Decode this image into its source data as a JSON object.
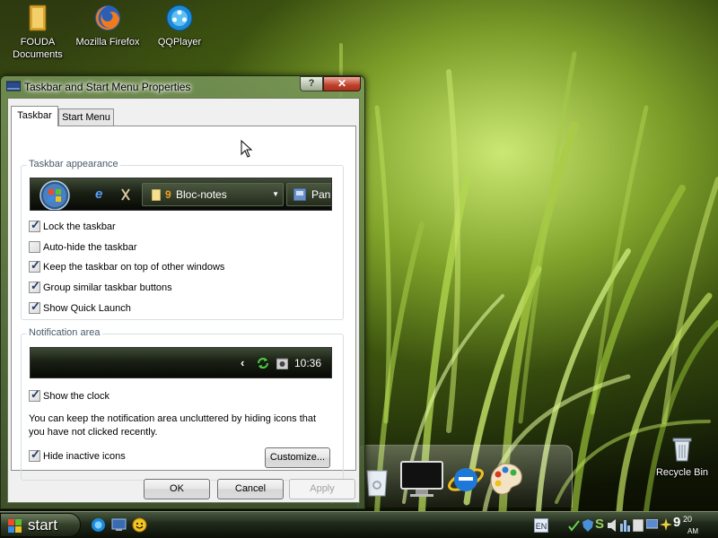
{
  "desktop": {
    "icons": [
      {
        "label": "FOUDA\nDocuments"
      },
      {
        "label": "Mozilla Firefox"
      },
      {
        "label": "QQPlayer"
      },
      {
        "label": "Recycle Bin"
      }
    ]
  },
  "window": {
    "title": "Taskbar and Start Menu Properties",
    "help_label": "?",
    "close_label": "✕",
    "tabs": [
      {
        "label": "Taskbar"
      },
      {
        "label": "Start Menu"
      }
    ],
    "appearance": {
      "title": "Taskbar appearance",
      "preview": {
        "task1_count": "9",
        "task1_label": "Bloc-notes",
        "task2_label": "Pann"
      },
      "options": [
        {
          "label": "Lock the taskbar",
          "checked": true
        },
        {
          "label": "Auto-hide the taskbar",
          "checked": false
        },
        {
          "label": "Keep the taskbar on top of other windows",
          "checked": true
        },
        {
          "label": "Group similar taskbar buttons",
          "checked": true
        },
        {
          "label": "Show Quick Launch",
          "checked": true
        }
      ]
    },
    "notification": {
      "title": "Notification area",
      "preview_time": "10:36",
      "show_clock": {
        "label": "Show the clock",
        "checked": true
      },
      "description": "You can keep the notification area uncluttered by hiding icons that you have not clicked recently.",
      "hide_inactive": {
        "label": "Hide inactive icons",
        "checked": true
      },
      "customize_label": "Customize..."
    },
    "buttons": {
      "ok": "OK",
      "cancel": "Cancel",
      "apply": "Apply"
    }
  },
  "taskbar": {
    "start_label": "start",
    "language": "EN",
    "clock_hour": "9",
    "clock_min": "20",
    "clock_ampm": "AM"
  }
}
